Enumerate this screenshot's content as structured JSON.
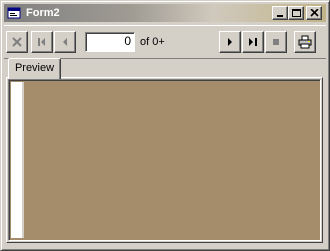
{
  "window": {
    "title": "Form2"
  },
  "toolbar": {
    "page_value": "0",
    "page_of_label": "of 0+"
  },
  "tabs": [
    {
      "label": "Preview"
    }
  ],
  "icons": {
    "app": "form-icon",
    "minimize": "minimize-icon",
    "maximize": "maximize-icon",
    "close": "close-icon",
    "stop_load": "cancel-x-icon",
    "first_page": "first-page-icon",
    "prev_page": "prev-page-icon",
    "next_page": "next-page-icon",
    "last_page": "last-page-icon",
    "stop": "stop-icon",
    "print": "printer-icon"
  },
  "colors": {
    "preview_background": "#a58c6a",
    "chrome": "#d4d0c8"
  }
}
